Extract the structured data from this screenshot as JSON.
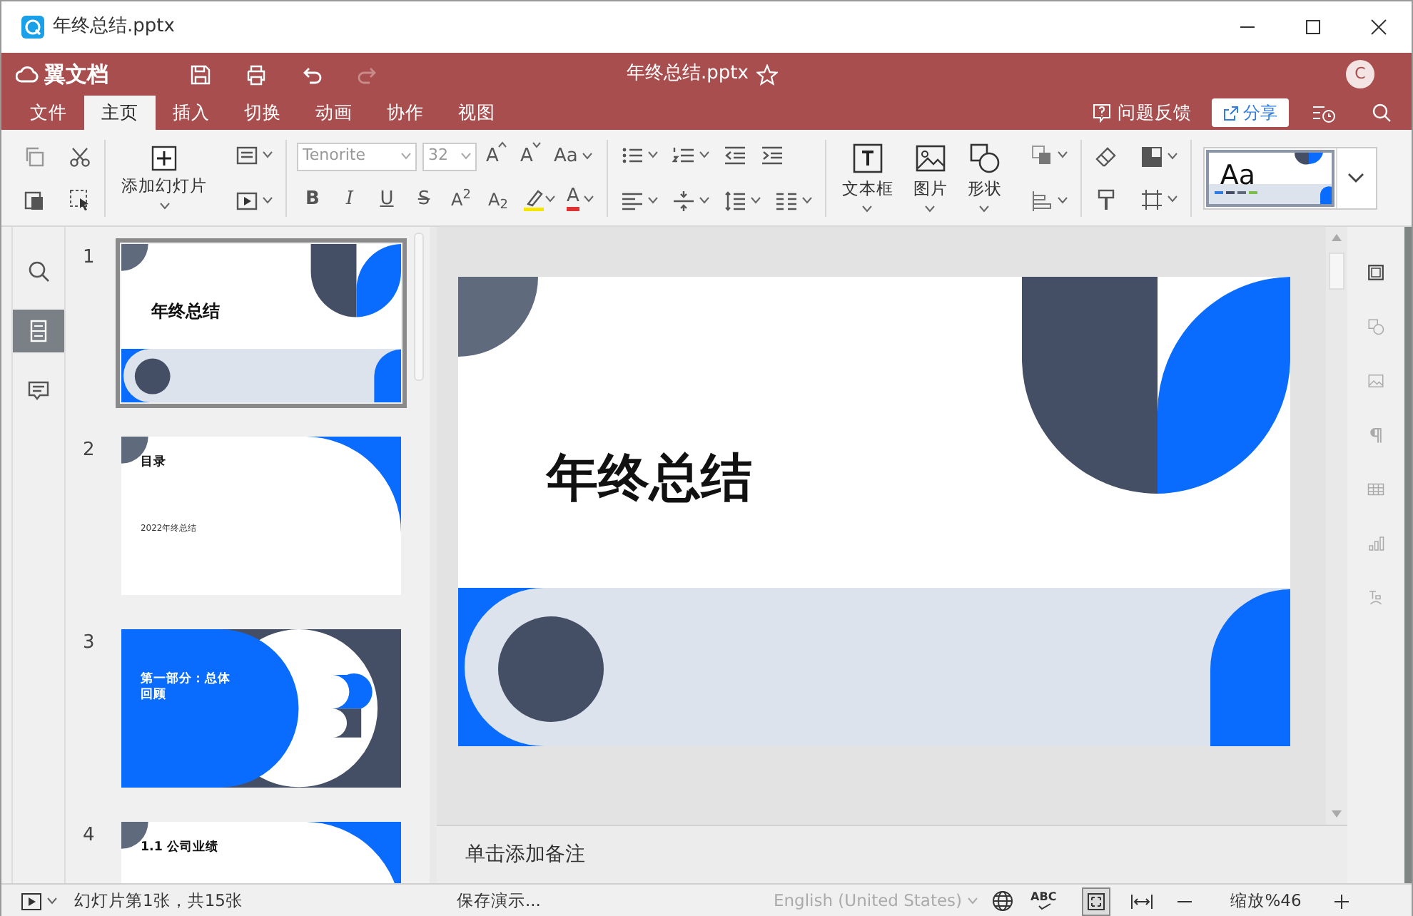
{
  "window": {
    "title": "年终总结.pptx"
  },
  "app_bar": {
    "brand": "翼文档",
    "document_title": "年终总结.pptx",
    "starred": false,
    "avatar": "C"
  },
  "menu_tabs": [
    {
      "label": "文件",
      "selected": false
    },
    {
      "label": "主页",
      "selected": true
    },
    {
      "label": "插入",
      "selected": false
    },
    {
      "label": "切换",
      "selected": false
    },
    {
      "label": "动画",
      "selected": false
    },
    {
      "label": "协作",
      "selected": false
    },
    {
      "label": "视图",
      "selected": false
    }
  ],
  "feedback": "问题反馈",
  "share": "分享",
  "ribbon": {
    "add_slide": "添加幻灯片",
    "font_family": "Tenorite",
    "font_size": "32",
    "grow_font": "A",
    "shrink_font": "A",
    "change_case": "Aa",
    "format_buttons": [
      {
        "kind": "bold",
        "label": "B"
      },
      {
        "kind": "italic",
        "label": "I"
      },
      {
        "kind": "underline",
        "label": "U"
      },
      {
        "kind": "strike",
        "label": "S"
      },
      {
        "kind": "script",
        "label": "A$^{2}$"
      },
      {
        "kind": "script",
        "label": "A$_{2}$"
      }
    ],
    "font_color": "A",
    "text_box": "文本框",
    "picture": "图片",
    "shape": "形状",
    "theme_preview": "Aa"
  },
  "left_rail": [
    {
      "kind": "search",
      "selected": false
    },
    {
      "kind": "slides",
      "selected": true
    },
    {
      "kind": "comments",
      "selected": false
    }
  ],
  "slides": [
    {
      "number": "1",
      "kind": "title",
      "title": "年终总结",
      "selected": true
    },
    {
      "number": "2",
      "kind": "toc",
      "title": "目录",
      "subtitle": "2022年终总结",
      "selected": false
    },
    {
      "number": "3",
      "kind": "section",
      "title": "第一部分：总体回顾",
      "selected": false
    },
    {
      "number": "4",
      "kind": "content",
      "title": "1.1 公司业绩",
      "selected": false
    }
  ],
  "current_slide": {
    "kind": "title",
    "title": "年终总结"
  },
  "notes_placeholder": "单击添加备注",
  "right_rail": [
    {
      "kind": "slide",
      "selected": true
    },
    {
      "kind": "shape",
      "selected": false
    },
    {
      "kind": "image",
      "selected": false
    },
    {
      "kind": "paragraph",
      "selected": false
    },
    {
      "kind": "table",
      "selected": false
    },
    {
      "kind": "chart",
      "selected": false
    },
    {
      "kind": "text-art",
      "selected": false
    }
  ],
  "status_bar": {
    "slide_info": "幻灯片第1张，共15张",
    "saving": "保存演示...",
    "language": "English (United States)",
    "spell_check": "ABC",
    "zoom": "缩放%46"
  }
}
